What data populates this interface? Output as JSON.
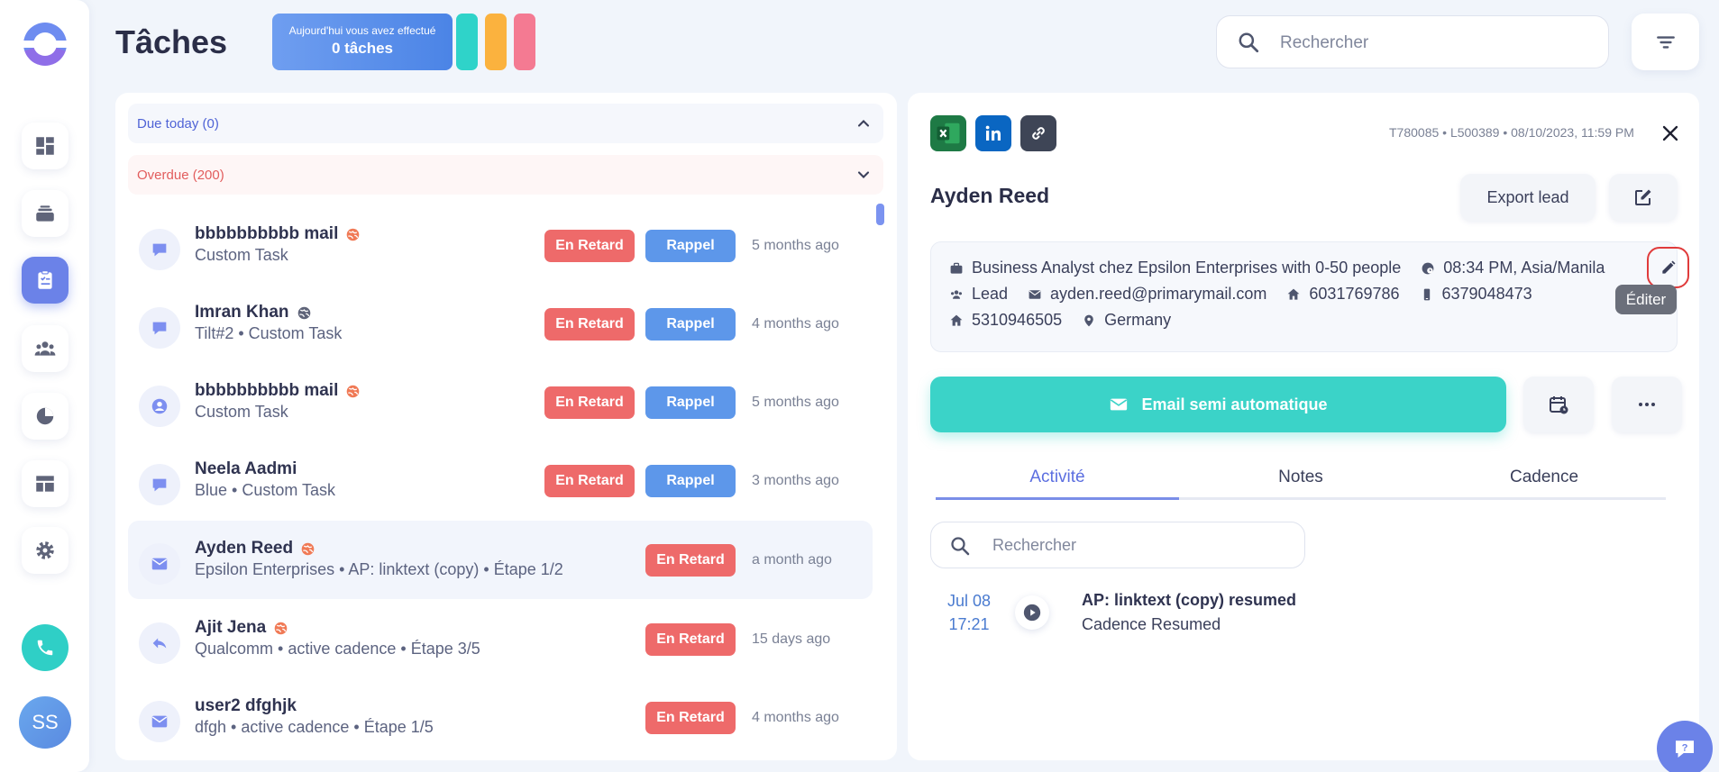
{
  "header": {
    "title": "Tâches",
    "today_line1": "Aujourd'hui vous avez effectué",
    "today_line2": "0 tâches",
    "pills": [
      "#2fd3c9",
      "#fbb23e",
      "#f47a92"
    ],
    "search_placeholder": "Rechercher"
  },
  "sidebar": {
    "items": [
      "dashboard-icon",
      "stack-icon",
      "tasks-icon",
      "people-icon",
      "pie-chart-icon",
      "layout-icon",
      "settings-icon"
    ],
    "active_index": 2,
    "avatar_initials": "SS"
  },
  "sections": {
    "due_today": "Due today (0)",
    "overdue": "Overdue (200)"
  },
  "tasks": [
    {
      "name": "bbbbbbbbbb mail",
      "sub": "Custom Task",
      "late": "En Retard",
      "remind": "Rappel",
      "ago": "5 months ago",
      "icon": "chat-icon",
      "globe": true
    },
    {
      "name": "Imran Khan",
      "sub": "Tilt#2 • Custom Task",
      "late": "En Retard",
      "remind": "Rappel",
      "ago": "4 months ago",
      "icon": "chat-icon",
      "globe": true
    },
    {
      "name": "bbbbbbbbbb mail",
      "sub": "Custom Task",
      "late": "En Retard",
      "remind": "Rappel",
      "ago": "5 months ago",
      "icon": "user-icon",
      "globe": true
    },
    {
      "name": "Neela Aadmi",
      "sub": "Blue • Custom Task",
      "late": "En Retard",
      "remind": "Rappel",
      "ago": "3 months ago",
      "icon": "chat-icon",
      "globe": false
    },
    {
      "name": "Ayden Reed",
      "sub": "Epsilon Enterprises • AP: linktext (copy) • Étape 1/2",
      "late": "En Retard",
      "remind": "",
      "ago": "a month ago",
      "icon": "mail-icon",
      "globe": true
    },
    {
      "name": "Ajit Jena",
      "sub": "Qualcomm • active cadence • Étape 3/5",
      "late": "En Retard",
      "remind": "",
      "ago": "15 days ago",
      "icon": "reply-icon",
      "globe": true
    },
    {
      "name": "user2 dfghjk",
      "sub": "dfgh • active cadence • Étape 1/5",
      "late": "En Retard",
      "remind": "",
      "ago": "4 months ago",
      "icon": "mail-icon",
      "globe": false
    }
  ],
  "detail": {
    "meta": "T780085 • L500389 • 08/10/2023, 11:59 PM",
    "lead_name": "Ayden Reed",
    "export_label": "Export lead",
    "job": "Business Analyst chez Epsilon Enterprises with 0-50 people",
    "local_time": "08:34 PM, Asia/Manila",
    "type": "Lead",
    "email": "ayden.reed@primarymail.com",
    "phone_home": "6031769786",
    "phone_mobile": "6379048473",
    "phone_home2": "5310946505",
    "country": "Germany",
    "tooltip": "Éditer",
    "email_btn": "Email semi automatique",
    "tabs": [
      "Activité",
      "Notes",
      "Cadence"
    ],
    "search_placeholder": "Rechercher",
    "activity": {
      "date": "Jul 08",
      "time": "17:21",
      "title": "AP: linktext (copy) resumed",
      "sub": "Cadence Resumed"
    }
  }
}
